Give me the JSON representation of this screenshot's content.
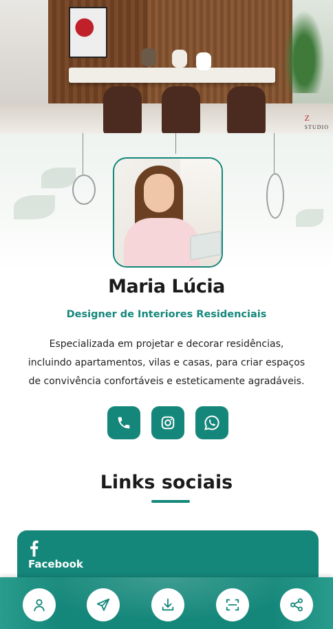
{
  "cover": {
    "logo_letter": "Z",
    "logo_text": "STUDIO"
  },
  "profile": {
    "name": "Maria Lúcia",
    "role": "Designer de Interiores Residenciais",
    "bio": "Especializada em projetar e decorar residências, incluindo apartamentos, vilas e casas, para criar espaços de convivência confortáveis e esteticamente agradáveis."
  },
  "contacts": [
    {
      "icon": "phone-icon"
    },
    {
      "icon": "instagram-icon"
    },
    {
      "icon": "whatsapp-icon"
    }
  ],
  "links_section": {
    "title": "Links sociais",
    "items": [
      {
        "icon": "facebook-icon",
        "label": "Facebook"
      }
    ]
  },
  "bottom_nav": [
    {
      "icon": "user-icon"
    },
    {
      "icon": "send-icon"
    },
    {
      "icon": "download-icon"
    },
    {
      "icon": "scan-icon"
    },
    {
      "icon": "share-icon"
    }
  ],
  "colors": {
    "accent": "#14877a",
    "text": "#1b1b1b",
    "background": "#ffffff"
  }
}
